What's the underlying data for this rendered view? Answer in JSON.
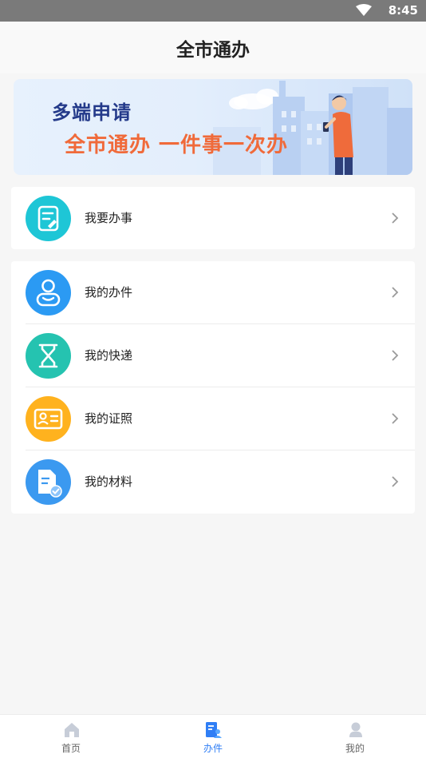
{
  "status_bar": {
    "time": "8:45"
  },
  "header": {
    "title": "全市通办"
  },
  "banner": {
    "line1": "多端申请",
    "line2": "全市通办  一件事一次办"
  },
  "menu_primary": [
    {
      "label": "我要办事",
      "icon": "form-icon",
      "color": "#1ec6d6"
    }
  ],
  "menu_secondary": [
    {
      "label": "我的办件",
      "icon": "user-profile-icon",
      "color": "#2b9af3"
    },
    {
      "label": "我的快递",
      "icon": "hourglass-icon",
      "color": "#25c3b0"
    },
    {
      "label": "我的证照",
      "icon": "id-card-icon",
      "color": "#ffb21e"
    },
    {
      "label": "我的材料",
      "icon": "document-check-icon",
      "color": "#3b99f0"
    }
  ],
  "tab_bar": {
    "tabs": [
      {
        "label": "首页",
        "icon": "home-icon",
        "active": false
      },
      {
        "label": "办件",
        "icon": "files-icon",
        "active": true
      },
      {
        "label": "我的",
        "icon": "person-icon",
        "active": false
      }
    ],
    "active_color": "#2f7ef5",
    "inactive_color": "#c7cdd8"
  }
}
